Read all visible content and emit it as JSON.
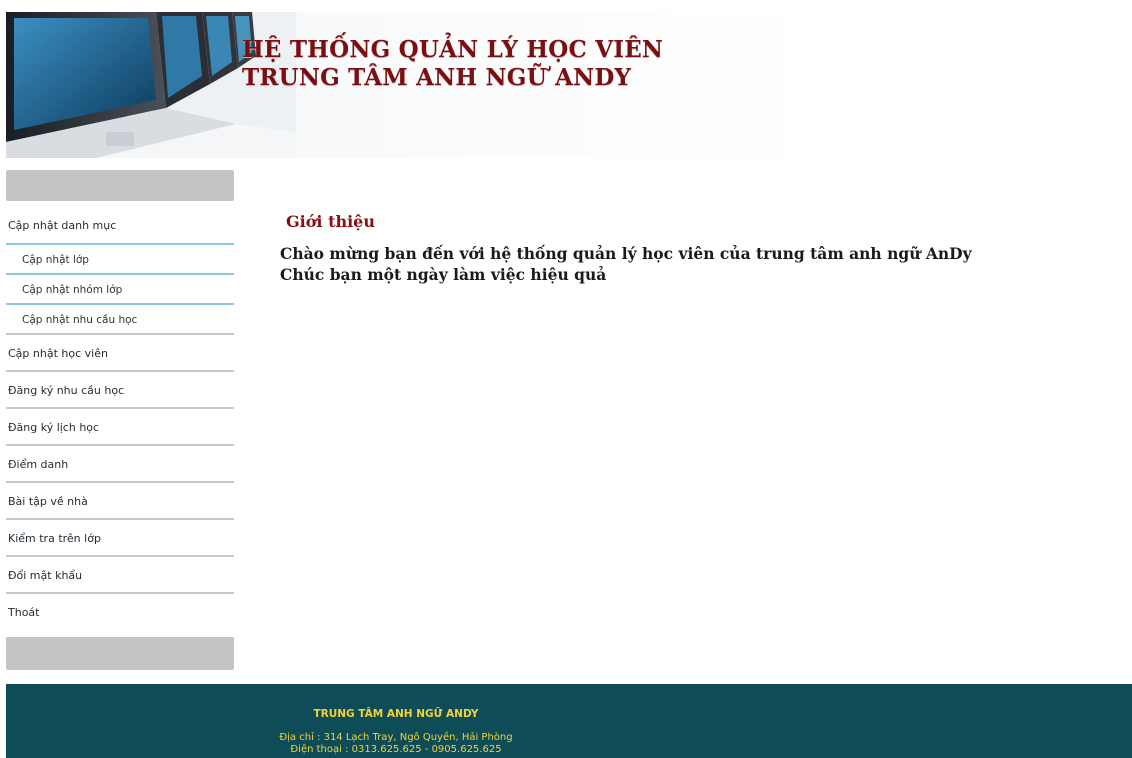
{
  "header": {
    "title_line1": "HỆ THỐNG QUẢN LÝ HỌC VIÊN",
    "title_line2": "TRUNG TÂM ANH NGỮ ANDY"
  },
  "sidebar": {
    "items": [
      {
        "label": "Cập nhật danh mục"
      },
      {
        "label": "Cập nhật lớp"
      },
      {
        "label": "Cập nhật nhóm lớp"
      },
      {
        "label": "Cập nhật nhu cầu học"
      },
      {
        "label": "Cập nhật học viên"
      },
      {
        "label": "Đăng ký nhu cầu học"
      },
      {
        "label": "Đăng ký lịch học"
      },
      {
        "label": "Điểm danh"
      },
      {
        "label": "Bài tập về nhà"
      },
      {
        "label": "Kiểm tra trên lớp"
      },
      {
        "label": "Đổi mật khẩu"
      },
      {
        "label": "Thoát"
      }
    ]
  },
  "main": {
    "title": "Giới thiệu",
    "welcome_line1": "Chào mừng bạn đến với hệ thống quản lý học viên của trung tâm anh ngữ AnDy",
    "welcome_line2": "Chúc bạn một ngày làm việc hiệu quả"
  },
  "footer": {
    "org": "TRUNG TÂM ANH NGỮ ANDY",
    "address": "Địa chỉ : 314 Lạch Tray, Ngô Quyền, Hải Phòng",
    "phone": "Điện thoại : 0313.625.625 - 0905.625.625"
  },
  "colors": {
    "title_red": "#7a0f12",
    "footer_bg": "#0e4d57",
    "footer_text": "#f1d23a",
    "menu_accent": "#8ec6e0"
  }
}
